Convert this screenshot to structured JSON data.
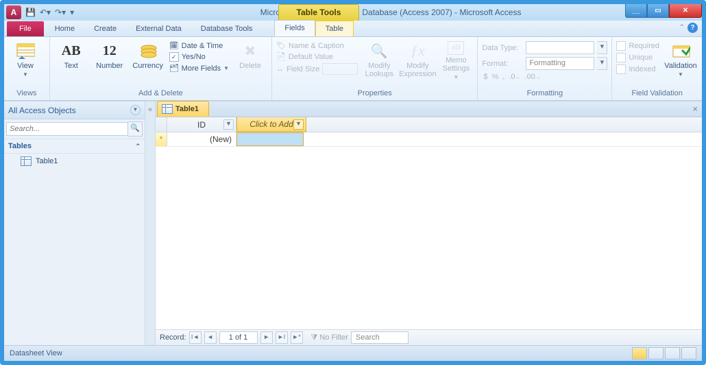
{
  "title": "MicrosoftAccessDatabase : Database (Access 2007)  -  Microsoft Access",
  "contextual_tab_group": "Table Tools",
  "tabs": {
    "file": "File",
    "home": "Home",
    "create": "Create",
    "external": "External Data",
    "dbtools": "Database Tools",
    "fields": "Fields",
    "table": "Table"
  },
  "ribbon": {
    "views": {
      "view_label": "View",
      "group": "Views"
    },
    "add_delete": {
      "text": "Text",
      "number": "Number",
      "currency": "Currency",
      "date_time": "Date & Time",
      "yes_no": "Yes/No",
      "more_fields": "More Fields",
      "delete": "Delete",
      "group": "Add & Delete"
    },
    "properties": {
      "name_caption": "Name & Caption",
      "default_value": "Default Value",
      "field_size": "Field Size",
      "modify_lookups": "Modify Lookups",
      "modify_expression": "Modify Expression",
      "memo_settings": "Memo Settings",
      "group": "Properties"
    },
    "formatting": {
      "data_type": "Data Type:",
      "format": "Format:",
      "format_placeholder": "Formatting",
      "currency_sym": "$",
      "percent": "%",
      "comma": ",",
      "dec_inc": ".0↑",
      "dec_dec": ".00↓",
      "group": "Formatting"
    },
    "validation": {
      "required": "Required",
      "unique": "Unique",
      "indexed": "Indexed",
      "validation": "Validation",
      "group": "Field Validation"
    }
  },
  "nav": {
    "header": "All Access Objects",
    "search_placeholder": "Search...",
    "group_tables": "Tables",
    "items": [
      "Table1"
    ]
  },
  "doc": {
    "tab": "Table1",
    "columns": {
      "id": "ID",
      "add": "Click to Add"
    },
    "new_row_marker": "*",
    "new_value": "(New)"
  },
  "record_nav": {
    "label": "Record:",
    "position": "1 of 1",
    "no_filter": "No Filter",
    "search": "Search"
  },
  "status": {
    "view": "Datasheet View"
  }
}
